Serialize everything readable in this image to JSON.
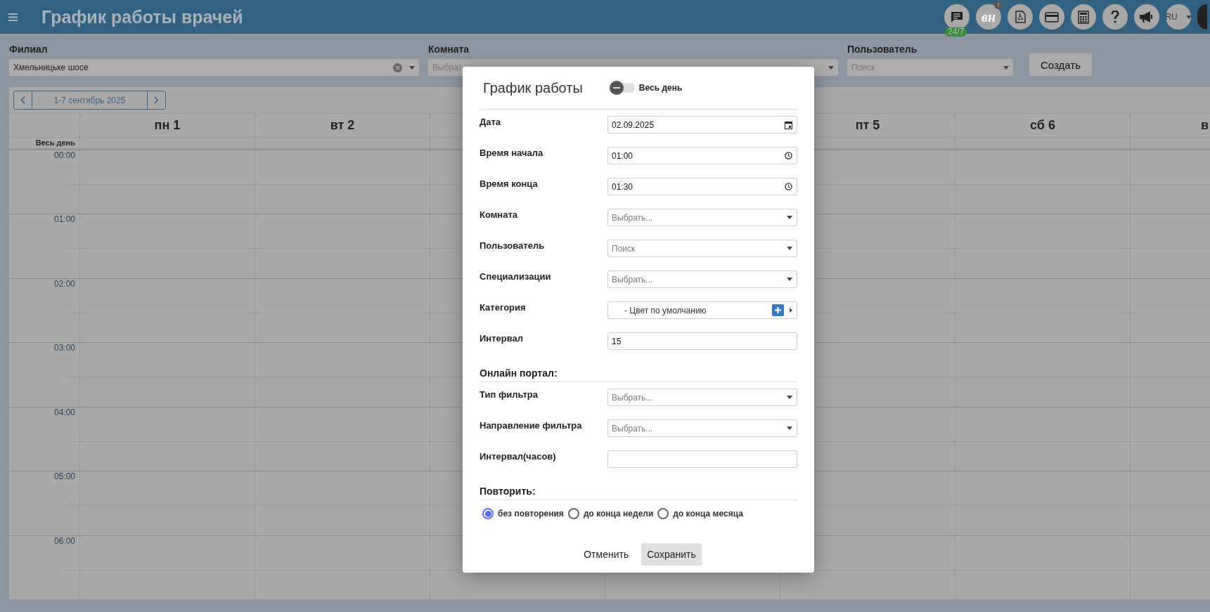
{
  "header": {
    "title": "График работы врачей",
    "icons": [
      {
        "kind": "chat",
        "badge": "24/7"
      },
      {
        "kind": "logo",
        "text": "вн",
        "badge": "!"
      },
      {
        "kind": "pdf"
      },
      {
        "kind": "card"
      },
      {
        "kind": "calculator"
      },
      {
        "kind": "help"
      },
      {
        "kind": "megaphone"
      },
      {
        "kind": "language",
        "text": "RU"
      }
    ]
  },
  "filters": [
    {
      "label": "Филиал",
      "value": "Хмельницьке шосе",
      "clearable": true
    },
    {
      "label": "Комната",
      "placeholder": "Выбрат",
      "clearable": false
    },
    {
      "label": "Пользователь",
      "placeholder": "Поиск",
      "clearable": false
    }
  ],
  "create_button": "Создать",
  "calendar": {
    "range": "1-7 сентябрь 2025",
    "all_day_label": "Весь день",
    "days_left": [
      "пн 1",
      "вт 2"
    ],
    "days_right": [
      "пт 5",
      "сб 6",
      "в"
    ],
    "times": [
      "00:00",
      "01:00",
      "02:00",
      "03:00",
      "04:00",
      "05:00",
      "06:00"
    ]
  },
  "modal": {
    "title": "График работы",
    "all_day": {
      "label": "Весь день",
      "on": false
    },
    "fields": [
      {
        "label": "Дата",
        "kind": "date",
        "value": "02.09.2025"
      },
      {
        "label": "Время начала",
        "kind": "time",
        "value": "01:00"
      },
      {
        "label": "Время конца",
        "kind": "time",
        "value": "01:30"
      },
      {
        "label": "Комната",
        "kind": "select",
        "placeholder": "Выбрать..."
      },
      {
        "label": "Пользователь",
        "kind": "select",
        "placeholder": "Поиск"
      },
      {
        "label": "Специализации",
        "kind": "select",
        "placeholder": "Выбрать..."
      },
      {
        "label": "Категория",
        "kind": "category",
        "value": "- Цвет по умолчанию"
      },
      {
        "label": "Интервал",
        "kind": "text",
        "value": "15"
      }
    ],
    "portal": {
      "title": "Онлайн портал:",
      "fields": [
        {
          "label": "Тип фильтра",
          "kind": "select",
          "placeholder": "Выбрать..."
        },
        {
          "label": "Направление фильтра",
          "kind": "select",
          "placeholder": "Выбрать..."
        },
        {
          "label": "Интервал(часов)",
          "kind": "text"
        }
      ]
    },
    "repeat": {
      "title": "Повторить:",
      "options": [
        {
          "label": "без повторения",
          "selected": true
        },
        {
          "label": "до конца недели",
          "selected": false
        },
        {
          "label": "до конца месяца",
          "selected": false
        }
      ]
    },
    "buttons": [
      {
        "label": "Отменить",
        "kind": "plain"
      },
      {
        "label": "Сохранить",
        "kind": "primary"
      }
    ]
  }
}
